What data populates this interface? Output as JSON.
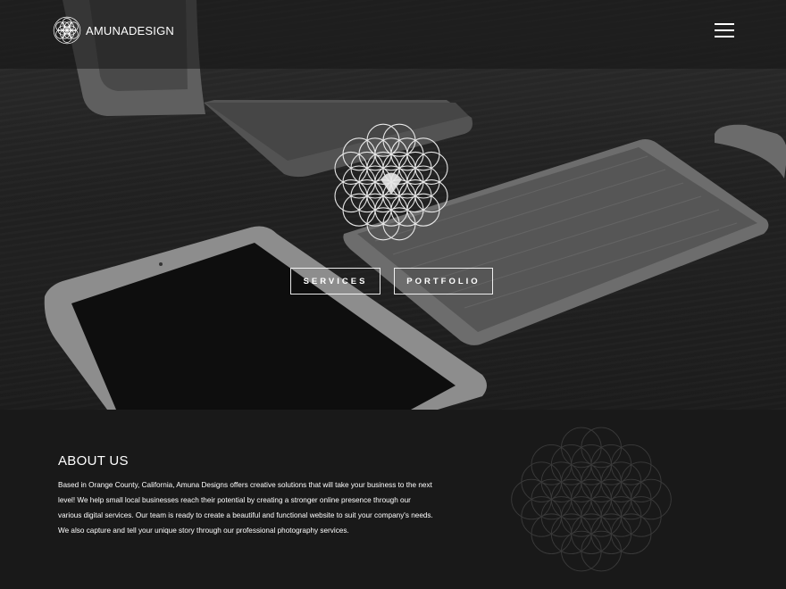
{
  "header": {
    "brand": "AMUNADESIGN",
    "logo_icon": "flower-of-life-icon",
    "menu_icon": "hamburger-menu-icon"
  },
  "hero": {
    "emblem_icon": "flower-of-life-icon",
    "buttons": {
      "services": "SERVICES",
      "portfolio": "PORTFOLIO"
    }
  },
  "about": {
    "title": "ABOUT US",
    "body": "Based in Orange County, California, Amuna Designs offers creative solutions that will take your business to the next level! We help small local businesses reach their potential by creating a stronger online presence through our various digital services. Our team is ready to create a beautiful and functional website to suit your company's needs. We also capture and tell your unique story through our professional photography services.",
    "background_icon": "flower-of-life-icon"
  },
  "colors": {
    "background": "#1a1a1a",
    "text": "#ffffff",
    "accent": "#ffffff"
  }
}
